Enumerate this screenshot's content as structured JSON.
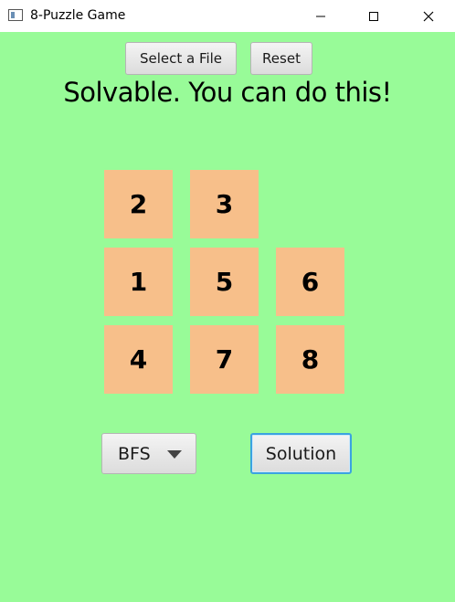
{
  "window": {
    "title": "8-Puzzle Game",
    "background": "#98fb98"
  },
  "toolbar": {
    "select_file_label": "Select a File",
    "reset_label": "Reset"
  },
  "status": {
    "message": "Solvable. You can do this!"
  },
  "board": {
    "tile_color": "#f7bf8a",
    "rows": [
      [
        "2",
        "3",
        ""
      ],
      [
        "1",
        "5",
        "6"
      ],
      [
        "4",
        "7",
        "8"
      ]
    ]
  },
  "controls": {
    "algorithm_selected": "BFS",
    "solution_label": "Solution",
    "focus_color": "#3ba3e0"
  },
  "icons": {
    "app": "app-window-icon",
    "minimize": "minimize-icon",
    "maximize": "maximize-icon",
    "close": "close-icon",
    "dropdown": "chevron-down-icon"
  }
}
